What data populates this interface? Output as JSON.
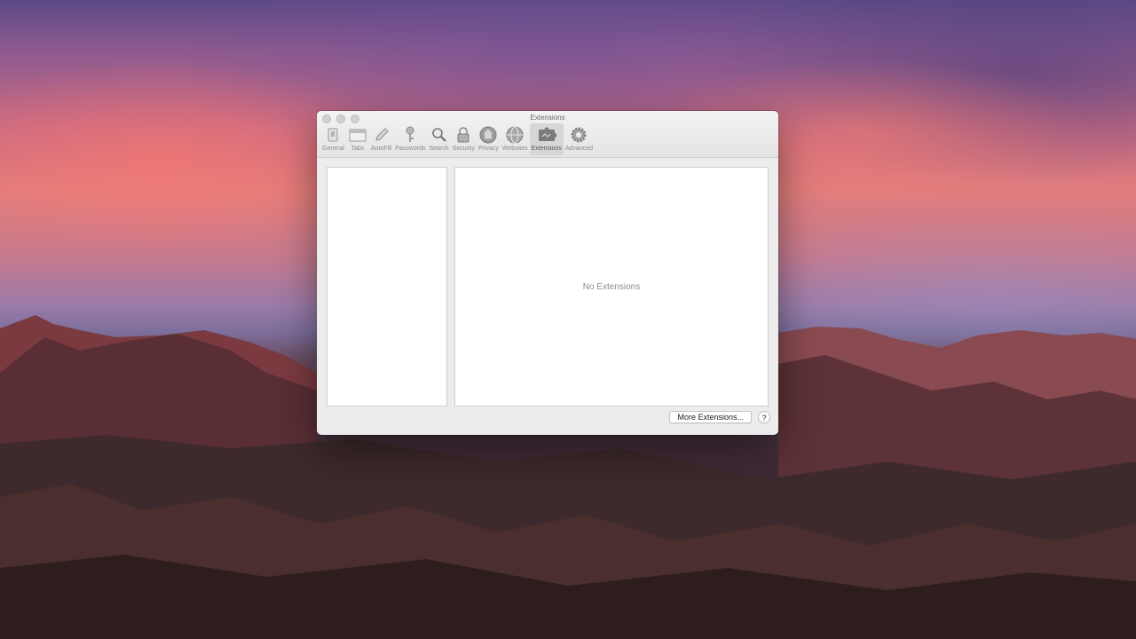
{
  "window": {
    "title": "Extensions"
  },
  "toolbar": {
    "items": [
      {
        "label": "General",
        "icon": "general-icon"
      },
      {
        "label": "Tabs",
        "icon": "tabs-icon"
      },
      {
        "label": "AutoFill",
        "icon": "pencil-icon"
      },
      {
        "label": "Passwords",
        "icon": "key-icon"
      },
      {
        "label": "Search",
        "icon": "search-icon"
      },
      {
        "label": "Security",
        "icon": "lock-icon"
      },
      {
        "label": "Privacy",
        "icon": "hand-icon"
      },
      {
        "label": "Websites",
        "icon": "globe-icon"
      },
      {
        "label": "Extensions",
        "icon": "puzzle-icon",
        "selected": true
      },
      {
        "label": "Advanced",
        "icon": "gear-icon"
      }
    ]
  },
  "extensions": {
    "empty_message": "No Extensions"
  },
  "footer": {
    "more_button": "More Extensions...",
    "help_button": "?"
  }
}
